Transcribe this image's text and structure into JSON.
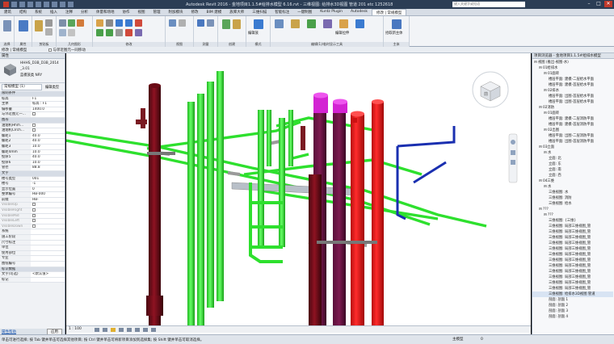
{
  "titlebar": {
    "title": "Autodesk Revit 2016 -   金地项目1.1.5#给排水模型 6.16.rvt - 三维视图: 给排水3D视图 管道 201 etc 1252618",
    "search_placeholder": "键入关键字或短语"
  },
  "tabs": [
    "建筑",
    "结构",
    "系统",
    "插入",
    "注释",
    "分析",
    "体量和场地",
    "协作",
    "视图",
    "管理",
    "附加模块",
    "修改",
    "BIM 建模",
    "族库大师",
    "三维扫描",
    "智能标注",
    "一键制图",
    "Kuntz Plugin",
    "Autodesk",
    "修改 | 常规模型"
  ],
  "tab_active_index": 19,
  "ribbon": {
    "groups": [
      {
        "label": "选择"
      },
      {
        "label": "属性"
      },
      {
        "label": "剪贴板"
      },
      {
        "label": "几何图形"
      },
      {
        "label": "修改"
      },
      {
        "label": "视图"
      },
      {
        "label": "测量"
      },
      {
        "label": "创建"
      },
      {
        "label": "模式"
      },
      {
        "label": "编辑(1)/临时显示工具"
      },
      {
        "label": "主体"
      }
    ],
    "buttons": [
      "编辑族",
      "修改",
      "编辑拉伸",
      "拾取新主体",
      "选择框"
    ]
  },
  "optbar": {
    "mode": "修改 | 常规模型",
    "checkbox_label": "与邻近图元一同移动"
  },
  "properties": {
    "header": "属性",
    "type_name_1": "HHHS_D3B_D3B_2014",
    "type_name_2": "_3.01",
    "type_name_3": "蓝模族类 NRY",
    "selector": "常规模型 (1)",
    "edit_type": "编辑类型",
    "rows": [
      {
        "k": "限制条件",
        "v": "",
        "sec": true
      },
      {
        "k": "标高",
        "v": "F1"
      },
      {
        "k": "主体",
        "v": "标高 : F1"
      },
      {
        "k": "偏移量",
        "v": "1400.0"
      },
      {
        "k": "与邻近图元一...",
        "v": "",
        "chk": true
      },
      {
        "k": "图形",
        "v": "",
        "sec": true
      },
      {
        "k": "油烟机Hh/h...",
        "v": "",
        "chk": true
      },
      {
        "k": "油烟机Clrch...",
        "v": "",
        "chk": true
      },
      {
        "k": "螺距1",
        "v": "40.0"
      },
      {
        "k": "螺距2",
        "v": "40.0"
      },
      {
        "k": "螺距3",
        "v": "10.0"
      },
      {
        "k": "螺距4mm",
        "v": "10.0"
      },
      {
        "k": "壁厚5",
        "v": "40.0"
      },
      {
        "k": "壁厚6",
        "v": "10.0"
      },
      {
        "k": "管径",
        "v": "88.8"
      },
      {
        "k": "文字",
        "v": "",
        "sec": true
      },
      {
        "k": "楼号类型",
        "v": "001"
      },
      {
        "k": "楼号",
        "v": "-1"
      },
      {
        "k": "显示位置",
        "v": "0"
      },
      {
        "k": "整体编号",
        "v": "HB-000"
      },
      {
        "k": "前缀",
        "v": "HB-"
      },
      {
        "k": "VisibleUp",
        "v": "",
        "chk": true,
        "dim": true
      },
      {
        "k": "VisibleRight",
        "v": "",
        "chk": true,
        "dim": true
      },
      {
        "k": "VisibleMid",
        "v": "",
        "chk": true,
        "dim": true
      },
      {
        "k": "VisibleLeft",
        "v": "",
        "chk": true,
        "dim": true
      },
      {
        "k": "VisibleDown",
        "v": "",
        "chk": true,
        "dim": true
      },
      {
        "k": "系统",
        "v": ""
      },
      {
        "k": "施工阶段",
        "v": ""
      },
      {
        "k": "尺寸标注",
        "v": ""
      },
      {
        "k": "单位",
        "v": ""
      },
      {
        "k": "使用部位",
        "v": ""
      },
      {
        "k": "专业",
        "v": ""
      },
      {
        "k": "图纸编号",
        "v": ""
      },
      {
        "k": "标识数据",
        "v": "",
        "sec": true
      },
      {
        "k": "文字(可选)",
        "v": "<默认值>"
      },
      {
        "k": "标记",
        "v": ""
      }
    ],
    "help_link": "属性帮助",
    "apply_button": "应用"
  },
  "browser": {
    "header": "项目浏览器 - 金地项目1.1.5#给排水模型",
    "items": [
      {
        "t": "⊟ 视图 (推出-视图-水)",
        "d": 0
      },
      {
        "t": "⊟ 01给排水",
        "d": 1
      },
      {
        "t": "⊟ 01面砖",
        "d": 2
      },
      {
        "t": "楼层平面: 建模-二层给水平面",
        "d": 3
      },
      {
        "t": "楼层平面: 建模-首层给水平面",
        "d": 3
      },
      {
        "t": "⊟ 02排水",
        "d": 2
      },
      {
        "t": "楼层平面: 出图-首层给水平面",
        "d": 3
      },
      {
        "t": "楼层平面: 出图-首层给水平面",
        "d": 3
      },
      {
        "t": "⊟ 02消防",
        "d": 1
      },
      {
        "t": "⊟ 01面砖",
        "d": 2
      },
      {
        "t": "楼层平面: 建模-二层消防平面",
        "d": 3
      },
      {
        "t": "楼层平面: 建模-首层消防平面",
        "d": 3
      },
      {
        "t": "⊟ 02出图",
        "d": 2
      },
      {
        "t": "楼层平面: 出图-二层消防平面",
        "d": 3
      },
      {
        "t": "楼层平面: 出图-首层消防平面",
        "d": 3
      },
      {
        "t": "⊟ 03立面",
        "d": 1
      },
      {
        "t": "⊟ 水",
        "d": 2
      },
      {
        "t": "立面: 北",
        "d": 3
      },
      {
        "t": "立面: 东",
        "d": 3
      },
      {
        "t": "立面: 南",
        "d": 3
      },
      {
        "t": "立面: 西",
        "d": 3
      },
      {
        "t": "⊟ 04三维",
        "d": 1
      },
      {
        "t": "⊟ 水",
        "d": 2
      },
      {
        "t": "三维视图: 水",
        "d": 3
      },
      {
        "t": "三维视图: 消防",
        "d": 3
      },
      {
        "t": "三维视图: 给水",
        "d": 3
      },
      {
        "t": "⊟ ???",
        "d": 1
      },
      {
        "t": "⊟ ???",
        "d": 2
      },
      {
        "t": "三维视图: {三维}",
        "d": 3
      },
      {
        "t": "三维视图: 局部三维视图_管",
        "d": 3
      },
      {
        "t": "三维视图: 局部三维视图_管",
        "d": 3
      },
      {
        "t": "三维视图: 局部三维视图_管",
        "d": 3
      },
      {
        "t": "三维视图: 局部三维视图_管",
        "d": 3
      },
      {
        "t": "三维视图: 局部三维视图_管",
        "d": 3
      },
      {
        "t": "三维视图: 局部三维视图_管",
        "d": 3
      },
      {
        "t": "三维视图: 局部三维视图_管",
        "d": 3
      },
      {
        "t": "三维视图: 局部三维视图_管",
        "d": 3
      },
      {
        "t": "三维视图: 局部三维视图_管",
        "d": 3
      },
      {
        "t": "三维视图: 局部三维视图_管",
        "d": 3
      },
      {
        "t": "三维视图: 局部三维视图_管",
        "d": 3
      },
      {
        "t": "三维视图: 局部三维视图_管",
        "d": 3
      },
      {
        "t": "三维视图: 给排水3D视图 管道",
        "d": 3,
        "hl": true
      },
      {
        "t": "剖面: 剖面 1",
        "d": 3
      },
      {
        "t": "剖面: 剖面 2",
        "d": 3
      },
      {
        "t": "剖面: 剖面 3",
        "d": 3
      },
      {
        "t": "剖面: 剖面 4",
        "d": 3
      }
    ]
  },
  "viewcube": {
    "label": "前"
  },
  "viewctl": {
    "scale": "1 : 100"
  },
  "status": {
    "message": "单击可进行选择; 按 Tab 键并单击可选择其他项目; 按 Ctrl 键并单击可将新项目添加到选择集; 按 Shift 键并单击可取消选择。",
    "model": "主模型",
    "zoom": "0"
  },
  "colors": {
    "titlebar": "#2b3d55",
    "green_pipe": "#33ee33",
    "red_pipe": "#ee2222",
    "darkred_pipe": "#7a0c18",
    "magenta_pipe": "#cc22cc",
    "blue_pipe": "#1a2fb0"
  }
}
